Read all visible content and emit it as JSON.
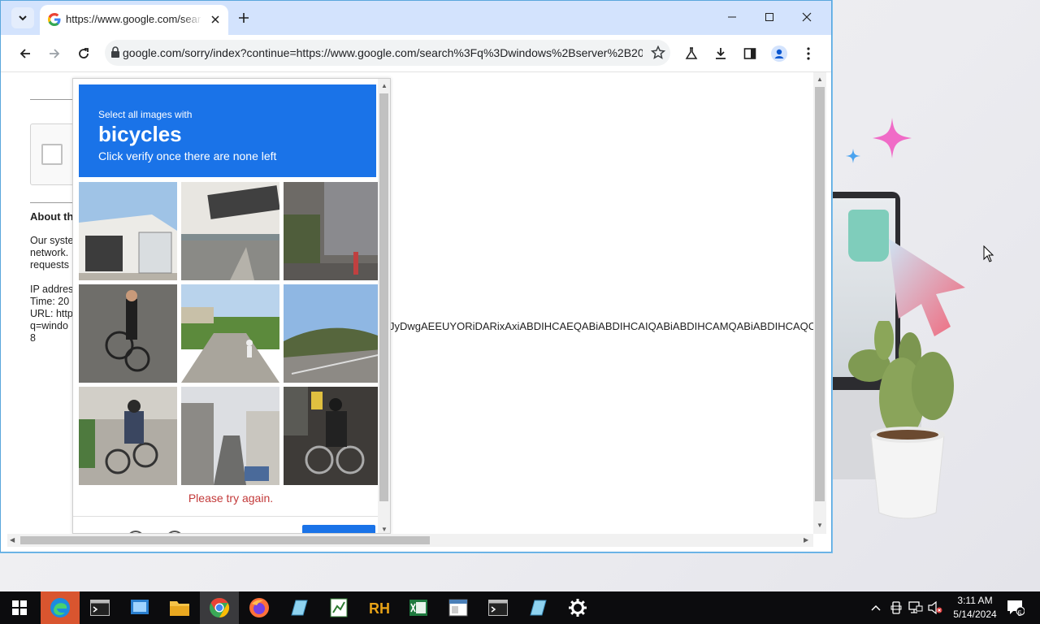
{
  "browser": {
    "tab_title": "https://www.google.com/sear",
    "url": "google.com/sorry/index?continue=https://www.google.com/search%3Fq%3Dwindows%2Bserver%2B20..."
  },
  "page": {
    "about_title": "About th",
    "about_lines": [
      "Our syste",
      "network.",
      "requests"
    ],
    "info_lines": [
      "IP addres",
      "Time: 20",
      "URL: http",
      "q=windo",
      "8"
    ],
    "token_text": "JyDwgAEEUYORiDARixAxiABDIHCAEQABiABDIHCAIQABiABDIHCAMQABiABDIHCAQC"
  },
  "challenge": {
    "instruction": "Select all images with",
    "target_word": "bicycles",
    "hint": "Click verify once there are none left",
    "error": "Please try again.",
    "tiles": [
      "street-building",
      "highway-sign",
      "tall-building-street",
      "person-with-bicycle",
      "road-with-pedestrian",
      "road-sky",
      "cyclist-street",
      "narrow-street",
      "cyclist-night"
    ]
  },
  "taskbar": {
    "time": "3:11 AM",
    "date": "5/14/2024",
    "notification_count": "5",
    "apps": [
      "start",
      "edge",
      "terminal",
      "file-explorer-app",
      "folder",
      "chrome",
      "firefox",
      "notepad",
      "spreadsheet",
      "rh-app",
      "excel",
      "window-app",
      "terminal-2",
      "notepad-2",
      "settings"
    ]
  },
  "colors": {
    "accent_blue": "#1a73e8",
    "error_red": "#c33a3a",
    "tabstrip": "#d3e3fd"
  }
}
